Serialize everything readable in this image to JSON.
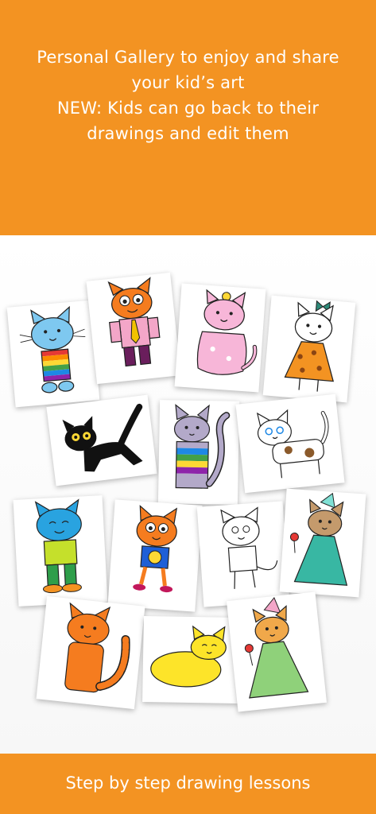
{
  "header": {
    "lines": [
      "Personal Gallery to enjoy and share",
      "your kid’s art",
      "NEW: Kids can go back to their",
      "drawings and edit them"
    ]
  },
  "gallery": {
    "drawings": [
      "blue-rainbow-cat-drawing",
      "orange-cat-in-suit-drawing",
      "fluffy-pink-cat-drawing",
      "cat-in-polka-dot-dress-drawing",
      "black-cat-drawing",
      "gray-striped-cat-drawing",
      "spotted-cat-drawing",
      "blue-cat-in-green-shirt-drawing",
      "orange-cat-smiley-shirt-drawing",
      "uncolored-cat-outline-drawing",
      "cat-princess-teal-dress-drawing",
      "orange-cat-sitting-drawing",
      "yellow-cat-sleeping-drawing",
      "cat-princess-green-dress-drawing"
    ]
  },
  "footer": {
    "caption": "Step by step drawing lessons"
  },
  "colors": {
    "banner": "#f39322",
    "gallery_background": "#f6f6f6",
    "text": "#ffffff"
  }
}
